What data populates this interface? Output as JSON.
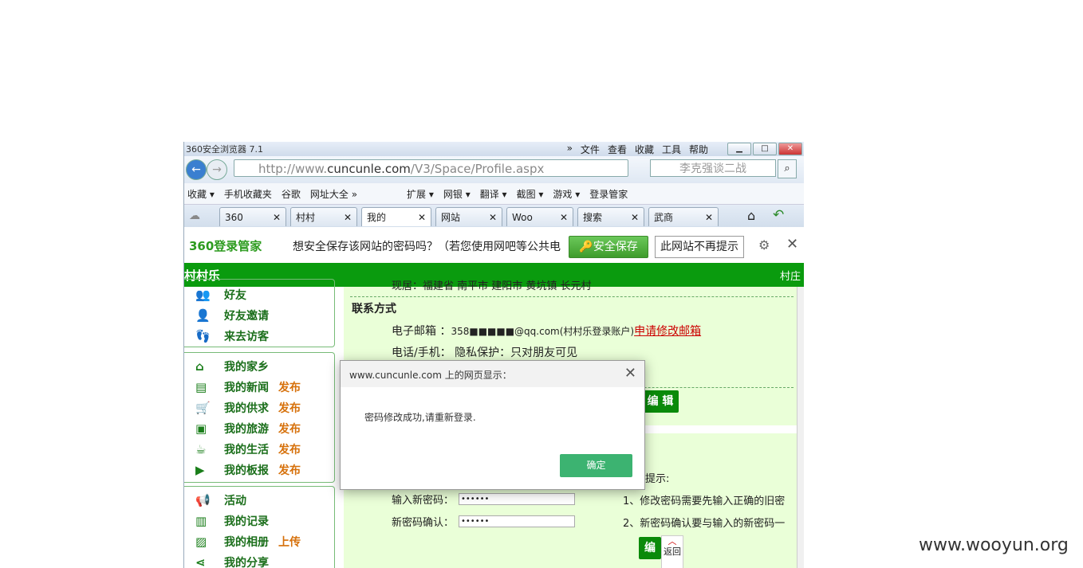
{
  "browser": {
    "title": "360安全浏览器 7.1",
    "menu": [
      "»",
      "文件",
      "查看",
      "收藏",
      "工具",
      "帮助"
    ],
    "url_prefix": "http://www.",
    "url_domain": "cuncunle.com",
    "url_path": "/V3/Space/Profile.aspx",
    "search_placeholder": "李克强谈二战",
    "favorites": [
      "收藏 ▾",
      "手机收藏夹",
      "谷歌",
      "网址大全 »",
      "扩展 ▾",
      "网银 ▾",
      "翻译 ▾",
      "截图 ▾",
      "游戏 ▾",
      "登录管家"
    ],
    "tabs": [
      "360",
      "村村",
      "我的",
      "网站",
      "Woo",
      "搜索",
      "武商"
    ]
  },
  "notify": {
    "logo": "360登录管家",
    "message": "想安全保存该网站的密码吗？（若您使用网吧等公共电",
    "save_label": "安全保存",
    "no_label": "此网站不再提示"
  },
  "site": {
    "brand": "村村乐",
    "right_text": "村庄",
    "sidebar_group1": [
      {
        "label": "好友",
        "icon": "friends-icon"
      },
      {
        "label": "好友邀请",
        "icon": "invite-icon"
      },
      {
        "label": "来去访客",
        "icon": "footprint-icon"
      }
    ],
    "sidebar_group2": [
      {
        "label": "我的家乡",
        "action": ""
      },
      {
        "label": "我的新闻",
        "action": "发布"
      },
      {
        "label": "我的供求",
        "action": "发布"
      },
      {
        "label": "我的旅游",
        "action": "发布"
      },
      {
        "label": "我的生活",
        "action": "发布"
      },
      {
        "label": "我的板报",
        "action": "发布"
      }
    ],
    "sidebar_group3": [
      {
        "label": "活动",
        "action": ""
      },
      {
        "label": "我的记录",
        "action": ""
      },
      {
        "label": "我的相册",
        "action": "上传"
      },
      {
        "label": "我的分享",
        "action": ""
      }
    ],
    "location_text": "现居：福建省 南平市 建阳市 黄坑镇 长元村",
    "contact_title": "联系方式",
    "email_label": "电子邮箱 ：",
    "email_value": "358■■■■■@qq.com(村村乐登录账户)",
    "email_change": "申请修改邮箱",
    "phone_label": "电话/手机：",
    "phone_value": "隐私保护：只对朋友可见",
    "edit_label": "编 辑",
    "hint_title": "提示:",
    "hint1": "1、修改密码需要先输入正确的旧密",
    "hint2": "2、新密码确认要与输入的新密码一",
    "new_pwd_label": "输入新密码：",
    "confirm_pwd_label": "新密码确认：",
    "pwd_mask": "••••••",
    "edit2_label": "编",
    "back_label": "返回"
  },
  "dialog": {
    "title": "www.cuncunle.com 上的网页显示：",
    "message": "密码修改成功,请重新登录.",
    "ok_label": "确定"
  },
  "watermark": "www.wooyun.org"
}
